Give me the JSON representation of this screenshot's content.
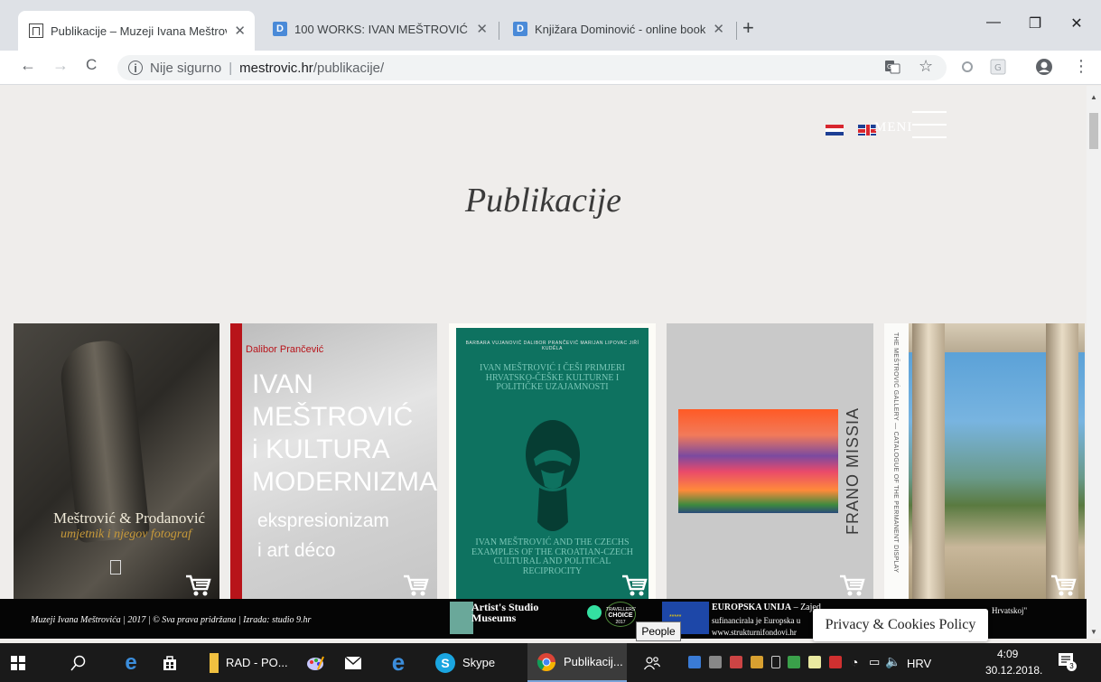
{
  "browser": {
    "tabs": [
      {
        "title": "Publikacije – Muzeji Ivana Meštrović",
        "favicon": "museum-icon",
        "active": true
      },
      {
        "title": "100 WORKS: IVAN MEŠTROVIĆ -",
        "favicon": "dominovic-icon",
        "active": false
      },
      {
        "title": "Knjižara Dominović - online book",
        "favicon": "dominovic-icon",
        "active": false
      }
    ],
    "new_tab_glyph": "+",
    "close_glyph": "✕",
    "window_controls": {
      "minimize": "—",
      "restore": "❐",
      "close": "✕"
    },
    "nav": {
      "back": "←",
      "forward": "→",
      "reload": "C"
    },
    "address": {
      "security_icon": "ⓘ",
      "security_label": "Nije sigurno",
      "separator": "|",
      "domain": "mestrovic.hr",
      "path": "/publikacije/"
    },
    "toolbar_icons": {
      "translate": "translate-icon",
      "star": "☆",
      "account": "account-icon",
      "more": "⋮"
    }
  },
  "site": {
    "lang_switch": [
      "hr-flag-icon",
      "uk-flag-icon"
    ],
    "menu_label": "MENI",
    "page_title": "Publikacije",
    "books": [
      {
        "title_line1": "Meštrović & Prodanović",
        "title_line2": "umjetnik i njegov fotograf"
      },
      {
        "author": "Dalibor Prančević",
        "title_lines": [
          "IVAN",
          "MEŠTROVIĆ",
          "i KULTURA",
          "MODERNIZMA"
        ],
        "subtitle_lines": [
          "ekspresionizam",
          "i art déco"
        ]
      },
      {
        "authors": "BARBARA VUJANOVIĆ     DALIBOR PRANČEVIĆ     MARIJAN LIPOVAC     JIŘÍ KUDĚLA",
        "title_hr": "IVAN MEŠTROVIĆ I ČEŠI PRIMJERI HRVATSKO-ČEŠKE KULTURNE I POLITIČKE UZAJAMNOSTI",
        "title_en": "IVAN MEŠTROVIĆ AND THE CZECHS EXAMPLES OF THE CROATIAN-CZECH CULTURAL AND POLITICAL RECIPROCITY"
      },
      {
        "title": "FRANO MISSIA"
      },
      {
        "series": "THE MEŠTROVIĆ GALLERY — CATALOGUE OF THE PERMANENT DISPLAY"
      }
    ],
    "footer": {
      "copyright": "Muzeji Ivana Meštrovića | 2017 | © Sva prava pridržana | Izrada: studio 9.hr",
      "asm_line1": "Artist's Studio",
      "asm_line2": "Museums",
      "ta_line1": "TRAVELLERS'",
      "ta_line2": "CHOICE",
      "ta_line3": "2017",
      "eu_title": "EUROPSKA UNIJA",
      "eu_title_rest": " – Zajed",
      "eu_line2": "sufinancirala je Europska u",
      "eu_line3": "www.strukturnifondovi.hr",
      "eu_tail": "Hrvatskoj\""
    },
    "privacy_label": "Privacy & Cookies Policy"
  },
  "tooltip": "People",
  "taskbar": {
    "items": [
      {
        "label": "RAD - PO...",
        "icon": "folder-icon"
      },
      {
        "label": "Skype",
        "icon": "skype-icon"
      },
      {
        "label": "Publikacij...",
        "icon": "chrome-icon"
      }
    ],
    "language": "HRV",
    "time": "4:09",
    "date": "30.12.2018.",
    "notification_count": "3"
  }
}
